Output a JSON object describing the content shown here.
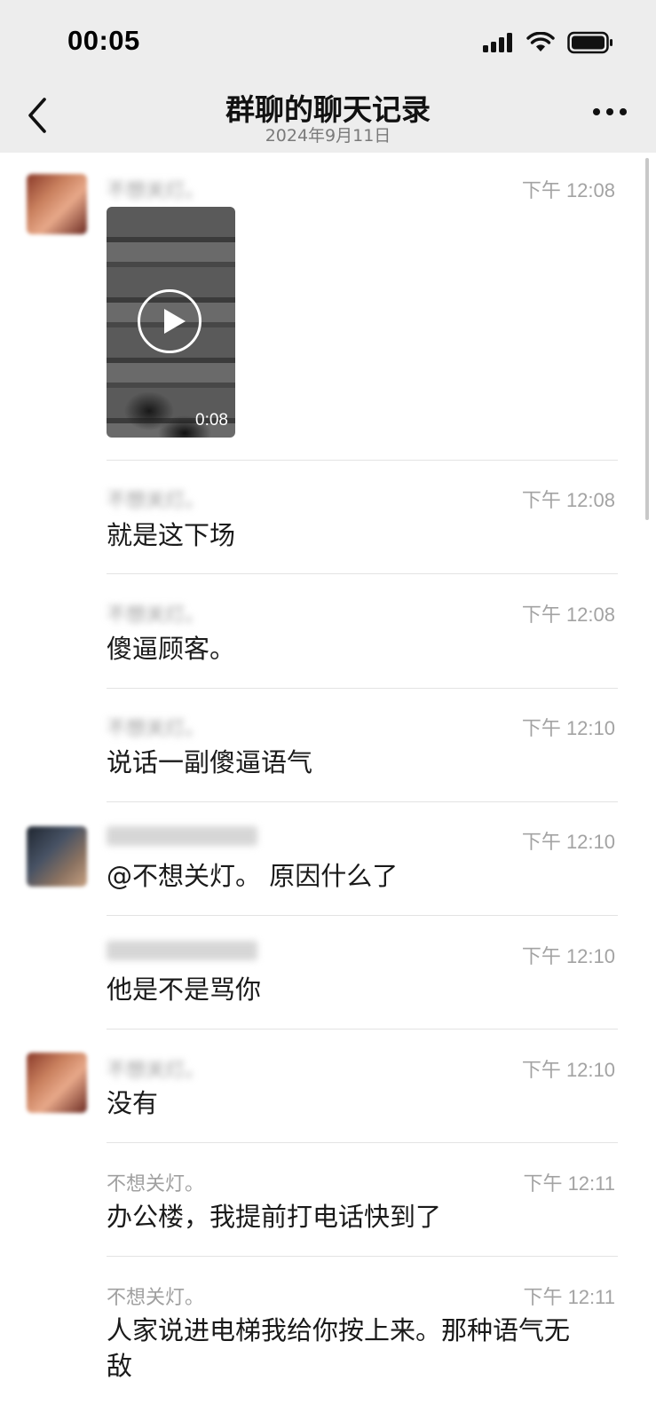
{
  "status_bar": {
    "time": "00:05"
  },
  "nav": {
    "title": "群聊的聊天记录",
    "subtitle": "2024年9月11日"
  },
  "messages": [
    {
      "sender": "不想关灯。",
      "time": "下午 12:08",
      "type": "video",
      "duration": "0:08",
      "avatar": "a",
      "sender_blurred": true
    },
    {
      "sender": "不想关灯。",
      "time": "下午 12:08",
      "text": "就是这下场",
      "sender_blurred": true
    },
    {
      "sender": "不想关灯。",
      "time": "下午 12:08",
      "text": "傻逼顾客。",
      "sender_blurred": true
    },
    {
      "sender": "不想关灯。",
      "time": "下午 12:10",
      "text": "说话一副傻逼语气",
      "sender_blurred": true
    },
    {
      "sender": "",
      "time": "下午 12:10",
      "text": "@不想关灯。 原因什么了",
      "avatar": "b",
      "sender_blurred": true
    },
    {
      "sender": "",
      "time": "下午 12:10",
      "text": "他是不是骂你",
      "sender_blurred": true
    },
    {
      "sender": "不想关灯。",
      "time": "下午 12:10",
      "text": "没有",
      "avatar": "a",
      "sender_blurred": true
    },
    {
      "sender": "不想关灯。",
      "time": "下午 12:11",
      "text": "办公楼，我提前打电话快到了",
      "sender_blurred": false
    },
    {
      "sender": "不想关灯。",
      "time": "下午 12:11",
      "text": "人家说进电梯我给你按上来。那种语气无敌",
      "sender_blurred": false
    }
  ],
  "colors": {
    "header_bg": "#ededed",
    "body_bg": "#ffffff",
    "meta_text": "#a0a0a0",
    "message_text": "#1a1a1a"
  },
  "icons": {
    "back": "chevron-left-icon",
    "more": "ellipsis-icon",
    "signal": "signal-icon",
    "wifi": "wifi-icon",
    "battery": "battery-icon",
    "play": "play-icon"
  }
}
